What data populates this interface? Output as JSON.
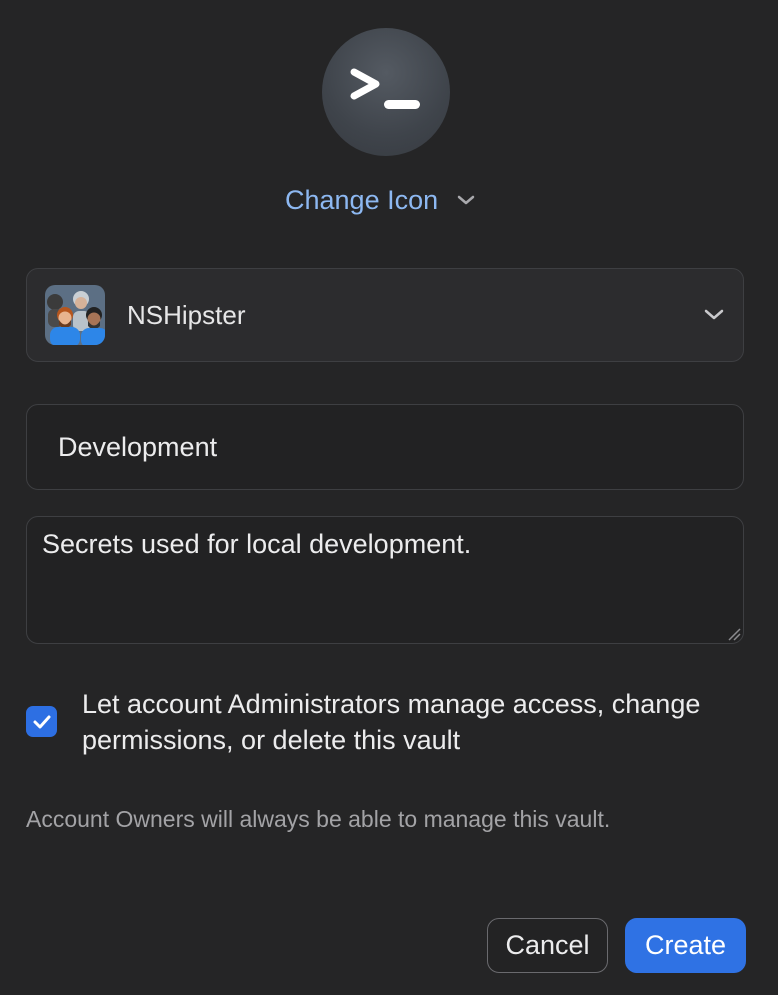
{
  "header": {
    "icon": "terminal-prompt-icon",
    "change_icon_label": "Change Icon"
  },
  "account": {
    "name": "NSHipster",
    "avatar": "team-avatar"
  },
  "form": {
    "vault_name": "Development",
    "description": "Secrets used for local development."
  },
  "permissions": {
    "checked": true,
    "label": "Let account Administrators manage access, change permissions, or delete this vault",
    "note": "Account Owners will always be able to manage this vault."
  },
  "actions": {
    "cancel_label": "Cancel",
    "create_label": "Create"
  },
  "colors": {
    "accent": "#2f72e4",
    "link": "#8db8f1",
    "background": "#252526"
  }
}
